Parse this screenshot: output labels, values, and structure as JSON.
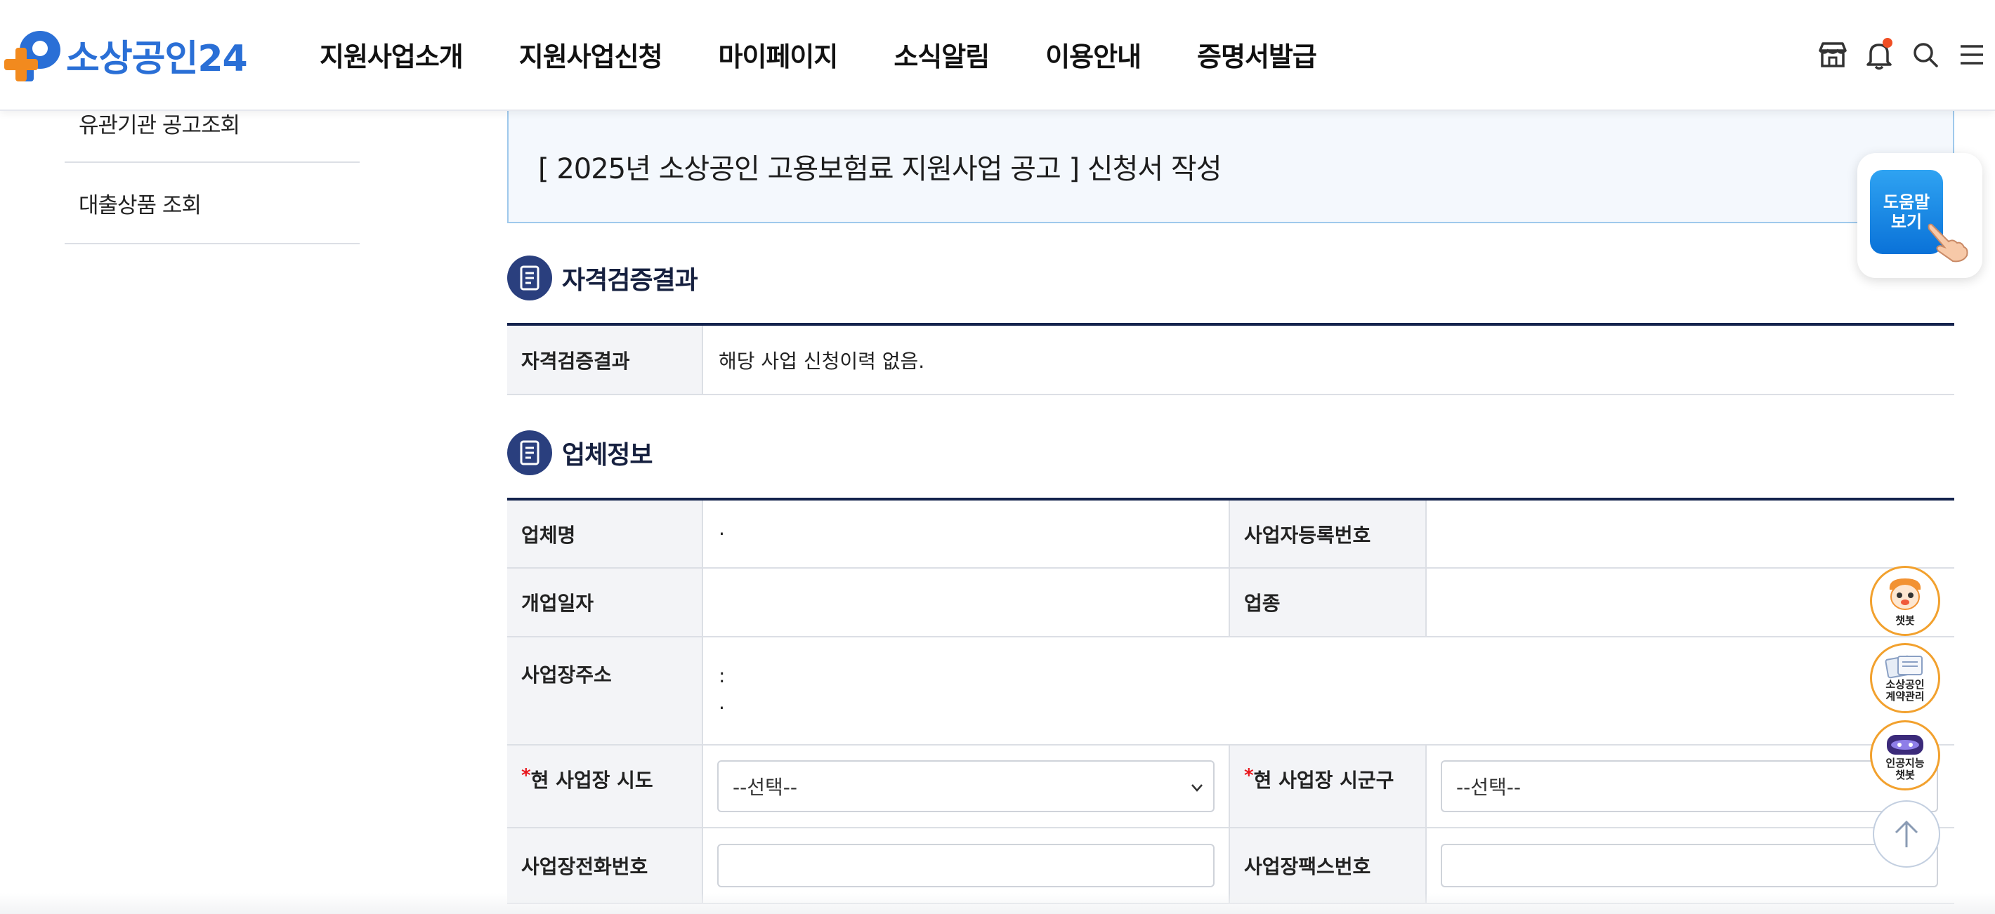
{
  "header": {
    "logo_text": "소상공인24",
    "nav": [
      "지원사업소개",
      "지원사업신청",
      "마이페이지",
      "소식알림",
      "이용안내",
      "증명서발급"
    ],
    "icons": [
      "store-icon",
      "bell-icon",
      "search-icon",
      "menu-icon"
    ]
  },
  "sidebar": {
    "items": [
      {
        "label": "유관기관 공고조회"
      },
      {
        "label": "대출상품 조회"
      }
    ]
  },
  "application": {
    "title": "[ 2025년 소상공인 고용보험료 지원사업 공고 ] 신청서 작성"
  },
  "qualification": {
    "section_title": "자격검증결과",
    "label": "자격검증결과",
    "value": "해당 사업 신청이력 없음."
  },
  "company": {
    "section_title": "업체정보",
    "name_label": "업체명",
    "name_value": "·",
    "bizno_label": "사업자등록번호",
    "bizno_value": "",
    "open_date_label": "개업일자",
    "open_date_value": "",
    "industry_label": "업종",
    "industry_value": "",
    "address_label": "사업장주소",
    "address_line1": ":",
    "address_line2": "·",
    "sido_label": "현 사업장 시도",
    "sido_required": "*",
    "sido_value": "--선택--",
    "sigungu_label": "현 사업장 시군구",
    "sigungu_required": "*",
    "sigungu_value": "--선택--",
    "phone_label": "사업장전화번호",
    "fax_label": "사업장팩스번호"
  },
  "floating": {
    "help_label": "도움말\n보기",
    "chatbot_label": "챗봇",
    "contract_label": "소상공인\n계약관리",
    "ai_chatbot_label": "인공지능\n챗봇"
  },
  "colors": {
    "brand_blue": "#2a6fd6",
    "brand_orange": "#f28a1e",
    "section_navy": "#14234d",
    "required_red": "#e8151b"
  }
}
